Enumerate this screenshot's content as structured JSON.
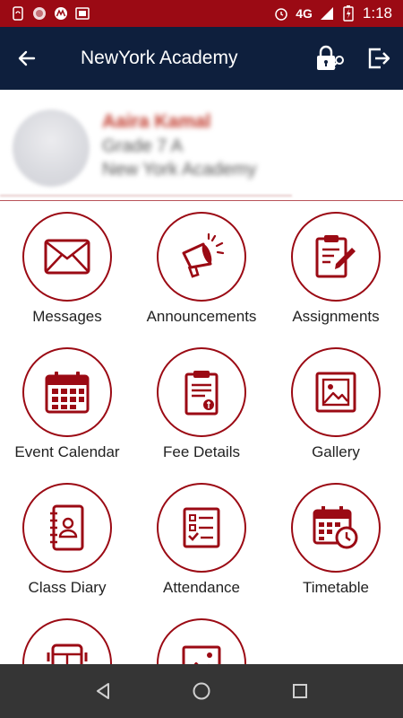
{
  "status_bar": {
    "network": "4G",
    "time": "1:18",
    "background": "#9b0a14"
  },
  "app_bar": {
    "title": "NewYork Academy",
    "background": "#0e1f3d"
  },
  "profile": {
    "name": "Aaira Kamal",
    "grade": "Grade 7  A",
    "school": "New York Academy"
  },
  "menu": {
    "accent": "#9b0a14",
    "items": [
      {
        "label": "Messages",
        "icon": "envelope-icon"
      },
      {
        "label": "Announcements",
        "icon": "megaphone-icon"
      },
      {
        "label": "Assignments",
        "icon": "clipboard-pencil-icon"
      },
      {
        "label": "Event Calendar",
        "icon": "calendar-icon"
      },
      {
        "label": "Fee Details",
        "icon": "fee-document-icon"
      },
      {
        "label": "Gallery",
        "icon": "picture-icon"
      },
      {
        "label": "Class Diary",
        "icon": "contact-book-icon"
      },
      {
        "label": "Attendance",
        "icon": "checklist-icon"
      },
      {
        "label": "Timetable",
        "icon": "calendar-clock-icon"
      },
      {
        "label": "",
        "icon": "bus-icon"
      },
      {
        "label": "",
        "icon": "image-frame-icon"
      }
    ]
  }
}
